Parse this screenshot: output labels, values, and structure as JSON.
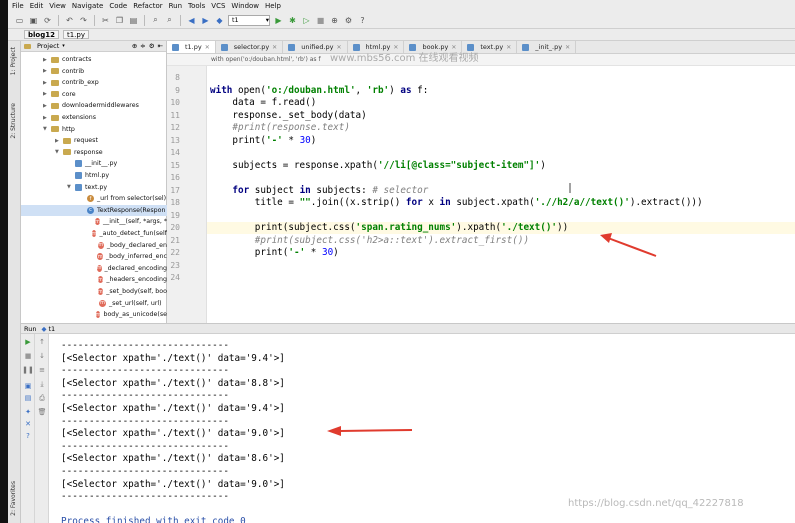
{
  "menu": [
    "File",
    "Edit",
    "View",
    "Navigate",
    "Code",
    "Refactor",
    "Run",
    "Tools",
    "VCS",
    "Window",
    "Help"
  ],
  "toolbar": {
    "run_config": "t1"
  },
  "breadcrumb": [
    "blog12",
    "t1.py"
  ],
  "left_tabs": [
    "1: Project",
    "2: Structure",
    "2: Favorites"
  ],
  "project": {
    "header": "Project",
    "items": [
      {
        "label": "contracts",
        "kind": "folder",
        "expanded": false
      },
      {
        "label": "contrib",
        "kind": "folder",
        "expanded": false
      },
      {
        "label": "contrib_exp",
        "kind": "folder",
        "expanded": false
      },
      {
        "label": "core",
        "kind": "folder",
        "expanded": false
      },
      {
        "label": "downloadermiddlewares",
        "kind": "folder",
        "expanded": false
      },
      {
        "label": "extensions",
        "kind": "folder",
        "expanded": false
      },
      {
        "label": "http",
        "kind": "folder",
        "expanded": true
      },
      {
        "label": "request",
        "kind": "folder",
        "expanded": false
      },
      {
        "label": "response",
        "kind": "folder",
        "expanded": true
      },
      {
        "label": "__init__.py",
        "kind": "py"
      },
      {
        "label": "html.py",
        "kind": "py"
      },
      {
        "label": "text.py",
        "kind": "py",
        "expanded": true
      },
      {
        "label": "_url from selector(sel)",
        "kind": "f"
      },
      {
        "label": "TextResponse(Respon",
        "kind": "c",
        "selected": true
      },
      {
        "label": "__init__(self, *args, *",
        "kind": "m"
      },
      {
        "label": "_auto_detect_fun(self",
        "kind": "m"
      },
      {
        "label": "_body_declared_en",
        "kind": "m"
      },
      {
        "label": "_body_inferred_enc",
        "kind": "m"
      },
      {
        "label": "_declared_encoding",
        "kind": "m"
      },
      {
        "label": "_headers_encoding",
        "kind": "m"
      },
      {
        "label": "_set_body(self, boo",
        "kind": "m"
      },
      {
        "label": "_set_url(self, url)",
        "kind": "m"
      },
      {
        "label": "body_as_unicode(se",
        "kind": "m"
      }
    ]
  },
  "editor_tabs": [
    {
      "label": "t1.py",
      "active": true
    },
    {
      "label": "selector.py",
      "active": false
    },
    {
      "label": "unified.py",
      "active": false
    },
    {
      "label": "html.py",
      "active": false
    },
    {
      "label": "book.py",
      "active": false
    },
    {
      "label": "text.py",
      "active": false
    },
    {
      "label": "_init_.py",
      "active": false
    }
  ],
  "editor_crumb": "with open('o:/douban.html', 'rb') as f",
  "editor": {
    "first_line": 8,
    "lines": [
      "",
      "with open('o:/douban.html', 'rb') as f:",
      "    data = f.read()",
      "    response._set_body(data)",
      "    #print(response.text)",
      "    print('-' * 30)",
      "",
      "    subjects = response.xpath('//li[@class=\"subject-item\"]')",
      "",
      "    for subject in subjects: # selector",
      "        title = \"\".join((x.strip() for x in subject.xpath('.//h2/a//text()').extract()))",
      "",
      "        print(subject.css('span.rating_nums').xpath('./text()'))",
      "        #print(subject.css('h2>a::text').extract_first())",
      "        print('-' * 30)",
      "",
      ""
    ],
    "highlight_line": 20
  },
  "run": {
    "header": "Run",
    "config": "t1",
    "output": [
      "------------------------------",
      "[<Selector xpath='./text()' data='9.4'>]",
      "------------------------------",
      "[<Selector xpath='./text()' data='8.8'>]",
      "------------------------------",
      "[<Selector xpath='./text()' data='9.4'>]",
      "------------------------------",
      "[<Selector xpath='./text()' data='9.0'>]",
      "------------------------------",
      "[<Selector xpath='./text()' data='8.6'>]",
      "------------------------------",
      "[<Selector xpath='./text()' data='9.0'>]",
      "------------------------------",
      "",
      "Process finished with exit code 0"
    ]
  },
  "watermark_top": "www.mbs56.com 在线观看视频",
  "watermark_bottom": "https://blog.csdn.net/qq_42227818",
  "colors": {
    "annotation_arrow": "#e03b2e",
    "keyword": "#000080",
    "string": "#008000",
    "comment": "#808080"
  }
}
